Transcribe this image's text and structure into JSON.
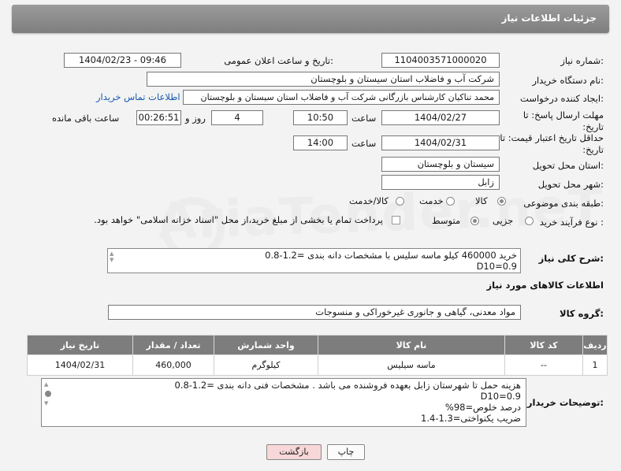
{
  "header": {
    "title": "جزئیات اطلاعات نیاز"
  },
  "fields": {
    "need_number_label": "شماره نیاز:",
    "need_number": "1104003571000020",
    "announce_label": "تاریخ و ساعت اعلان عمومی:",
    "announce_value": "1404/02/23 - 09:46",
    "buyer_org_label": "نام دستگاه خریدار:",
    "buyer_org": "شرکت آب و فاضلاب استان سیستان و بلوچستان",
    "creator_label": "ایجاد کننده درخواست:",
    "creator": "محمد تناکیان کارشناس بازرگانی شرکت آب و فاضلاب استان سیستان و بلوچستان",
    "contact_link": "اطلاعات تماس خریدار",
    "deadline_label": "مهلت ارسال پاسخ: تا تاریخ:",
    "deadline_date": "1404/02/27",
    "time_label": "ساعت",
    "deadline_time": "10:50",
    "days_value": "4",
    "days_label": "روز و",
    "remaining_value": "00:26:51",
    "remaining_label": "ساعت باقی مانده",
    "validity_label": "حداقل تاریخ اعتبار قیمت: تا تاریخ:",
    "validity_date": "1404/02/31",
    "validity_time_label": "ساعت",
    "validity_time": "14:00",
    "province_label": "استان محل تحویل:",
    "province": "سیستان و بلوچستان",
    "city_label": "شهر محل تحویل:",
    "city": "زابل",
    "category_label": "طبقه بندی موضوعی:",
    "category_options": [
      "کالا",
      "خدمت",
      "کالا/خدمت"
    ],
    "process_label": "نوع فرآیند خرید :",
    "process_options": [
      "جزیی",
      "متوسط"
    ],
    "payment_note": "پرداخت تمام یا بخشی از مبلغ خرید،از محل \"اسناد خزانه اسلامی\" خواهد بود."
  },
  "description": {
    "label": "شرح کلی نیاز:",
    "line1": "خرید 460000 کیلو ماسه سلیس با مشخصات دانه بندی  =1.2-0.8",
    "line2": "D10=0.9"
  },
  "goods": {
    "section_title": "اطلاعات کالاهای مورد نیاز",
    "group_label": "گروه کالا:",
    "group_value": "مواد معدنی، گیاهی و جانوری غیرخوراکی و منسوجات",
    "columns": [
      "ردیف",
      "کد کالا",
      "نام کالا",
      "واحد شمارش",
      "تعداد / مقدار",
      "تاریخ نیاز"
    ],
    "rows": [
      {
        "row": "1",
        "code": "--",
        "name": "ماسه سیلیس",
        "unit": "کیلوگرم",
        "qty": "460,000",
        "date": "1404/02/31"
      }
    ]
  },
  "buyer_notes": {
    "label": "توضیحات خریدار:",
    "lines": [
      "هزینه حمل تا شهرستان زابل بعهده فروشنده می باشد . مشخصات فنی دانه بندی =1.2-0.8",
      "D10=0.9",
      "درصد خلوص=98%",
      "ضریب یکنواختی=1.3-1.4"
    ]
  },
  "buttons": {
    "print": "چاپ",
    "back": "بازگشت"
  },
  "watermark": "AriaTender.neT",
  "colors": {
    "titlebar": "#8a8a8a",
    "link": "#1659b0",
    "back_button": "#f7d7d7"
  }
}
